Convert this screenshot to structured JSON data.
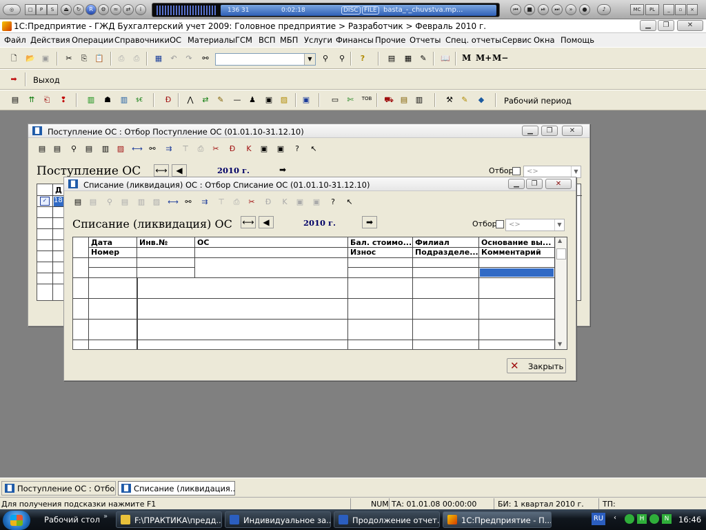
{
  "media": {
    "lcd_nums": "136   31",
    "lcd_time": "0:02:18",
    "lcd_disc": "DISC",
    "lcd_file": "FILE",
    "track": "basta_-_chuvstva.mp...",
    "mc": "MC",
    "pl": "PL"
  },
  "app": {
    "title": "1С:Предприятие - ГЖД Бухгалтерский учет 2009: Головное предприятие > Разработчик > Февраль 2010 г."
  },
  "menu": [
    "Файл",
    "Действия",
    "Операции",
    "Справочники",
    "ОС",
    "Материалы",
    "ГСМ",
    "ВСП",
    "МБП",
    "Услуги",
    "Финансы",
    "Прочие",
    "Отчеты",
    "Спец. отчеты",
    "Сервис",
    "Окна",
    "Помощь"
  ],
  "toolbar": {
    "m": "M",
    "m_plus": "M+",
    "m_minus": "M−",
    "exit_label": "Выход",
    "work_period": "Рабочий период"
  },
  "window_receipt": {
    "title": "Поступление ОС : Отбор Поступление ОС (01.01.10-31.12.10)",
    "header": "Поступление ОС",
    "year": "2010 г.",
    "filter_label": "Отбор",
    "filter_value": "<>",
    "col_first": "Д",
    "cell_first": "18"
  },
  "window_disposal": {
    "title": "Списание (ликвидация) ОС : Отбор Списание ОС (01.01.10-31.12.10)",
    "header": "Списание (ликвидация) ОС",
    "year": "2010 г.",
    "filter_label": "Отбор",
    "filter_value": "<>",
    "columns_top": [
      "Дата",
      "Инв.№",
      "ОС",
      "Бал. стоимо...",
      "Филиал",
      "Основание вы..."
    ],
    "columns_bottom": [
      "Номер",
      "",
      "",
      "Износ",
      "Подразделе...",
      "Комментарий"
    ],
    "close_label": "Закрыть"
  },
  "mdi_tabs": [
    "Поступление ОС : Отбо...",
    "Списание (ликвидация..."
  ],
  "status": {
    "hint": "Для получения подсказки нажмите F1",
    "num": "NUM",
    "ta": "ТА: 01.01.08  00:00:00",
    "bi": "БИ: 1 квартал 2010 г.",
    "tp": "ТП:"
  },
  "taskbar": {
    "desktop": "Рабочий стол",
    "tasks": [
      "F:\\ПРАКТИКА\\предд...",
      "Индивидуальное за...",
      "Продолжение отчет...",
      "1С:Предприятие - П..."
    ],
    "lang": "RU",
    "time": "16:46"
  }
}
